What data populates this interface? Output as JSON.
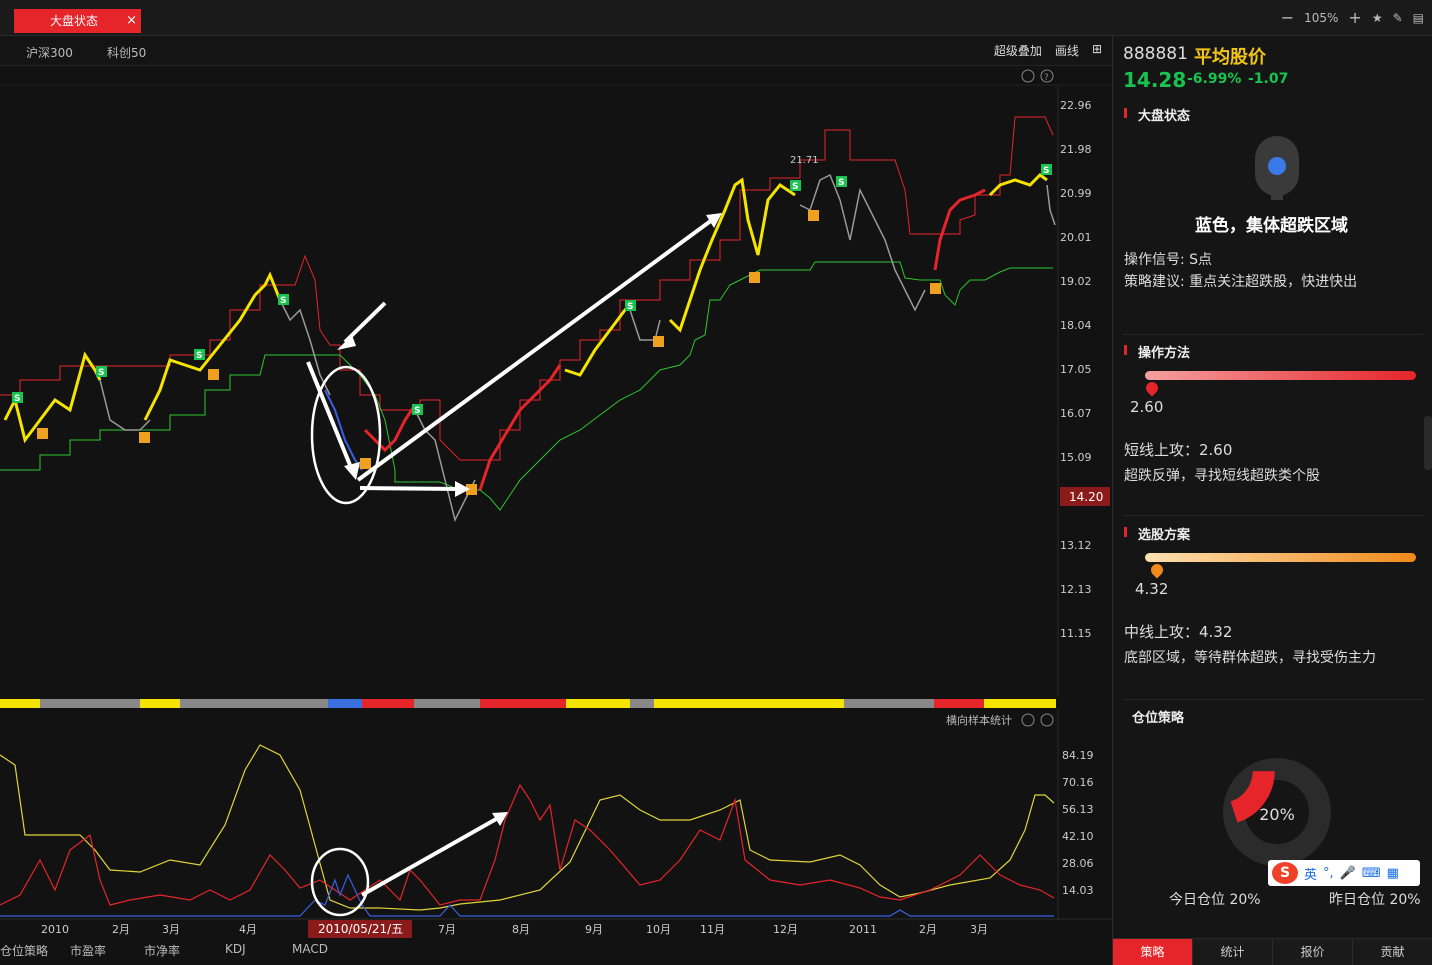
{
  "topbar": {
    "tab_label": "大盘状态",
    "tab_close": "×",
    "zoom": "105%"
  },
  "subbar": {
    "index1": "沪深300",
    "index2": "科创50",
    "overlay": "超级叠加",
    "draw": "画线"
  },
  "main_chart": {
    "y_ticks": [
      "22.96",
      "21.98",
      "20.99",
      "20.01",
      "19.02",
      "18.04",
      "17.05",
      "16.07",
      "15.09",
      "14.20",
      "13.12",
      "12.13",
      "11.15"
    ],
    "current_price_label": "14.20",
    "peak_label": "21.71"
  },
  "sub_chart": {
    "title": "横向样本统计",
    "y_ticks": [
      "84.19",
      "70.16",
      "56.13",
      "42.10",
      "28.06",
      "14.03"
    ],
    "x_ticks": [
      "2010",
      "2月",
      "3月",
      "4月",
      "7月",
      "8月",
      "9月",
      "10月",
      "11月",
      "12月",
      "2011",
      "2月",
      "3月"
    ],
    "cursor_date": "2010/05/21/五"
  },
  "indicator_tabs": [
    "仓位策略",
    "市盈率",
    "市净率",
    "KDJ",
    "MACD"
  ],
  "sidebar": {
    "code": "888881",
    "name": "平均股价",
    "price": "14.28",
    "change_pct": "-6.99%",
    "change": "-1.07",
    "section1_title": "大盘状态",
    "state_text": "蓝色，集体超跌区域",
    "signal": "操作信号: S点",
    "advice": "策略建议: 重点关注超跌股，快进快出",
    "section2_title": "操作方法",
    "method_value": "2.60",
    "method_line1": "短线上攻：2.60",
    "method_line2": "超跌反弹，寻找短线超跌类个股",
    "section3_title": "选股方案",
    "pick_value": "4.32",
    "pick_line1": "中线上攻：4.32",
    "pick_line2": "底部区域，等待群体超跌，寻找受伤主力",
    "section4_title": "仓位策略",
    "position_center": "20%",
    "position_fraction": 0.2,
    "today_position": "今日仓位 20%",
    "yesterday_position": "昨日仓位 20%",
    "bottom_tabs": [
      "策略",
      "统计",
      "报价",
      "贡献"
    ]
  },
  "ime": {
    "lang": "英"
  },
  "colors": {
    "accent": "#e5252a",
    "up": "#e5252a",
    "down": "#19c350",
    "yellow": "#f5e400"
  }
}
